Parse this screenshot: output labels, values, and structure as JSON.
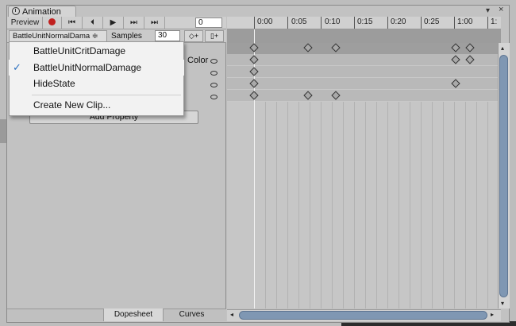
{
  "window": {
    "tab_title": "Animation",
    "window_controls": [
      "▾",
      "×"
    ]
  },
  "toolbar": {
    "preview_label": "Preview",
    "record_icon": "record-icon",
    "buttons": [
      "⏮",
      "⏴",
      "▶",
      "⏭",
      "⏭"
    ],
    "frame_value": "0"
  },
  "clip": {
    "selected": "BattleUnitNormalDama ≑",
    "samples_label": "Samples",
    "samples_value": "30",
    "add_keyframe": "◇+",
    "add_event": "▯+"
  },
  "properties": {
    "color_label": "Color",
    "add_property_label": "Add Property"
  },
  "dropdown": {
    "items": [
      {
        "label": "BattleUnitCritDamage",
        "checked": false
      },
      {
        "label": "BattleUnitNormalDamage",
        "checked": true
      },
      {
        "label": "HideState",
        "checked": false
      },
      {
        "label": "Create New Clip...",
        "checked": false
      }
    ],
    "check_glyph": "✓"
  },
  "timeline": {
    "ticks": [
      "0:00",
      "0:05",
      "0:10",
      "0:15",
      "0:20",
      "0:25",
      "1:00",
      "1:"
    ]
  },
  "bottom_tabs": {
    "dopesheet": "Dopesheet",
    "curves": "Curves"
  },
  "scroll": {
    "left": "◂",
    "right": "▸",
    "up": "▴",
    "down": "▾"
  },
  "colors": {
    "accent": "#2a6fc0",
    "record": "#c0201f",
    "scroll_thumb": "#7f97b3"
  }
}
